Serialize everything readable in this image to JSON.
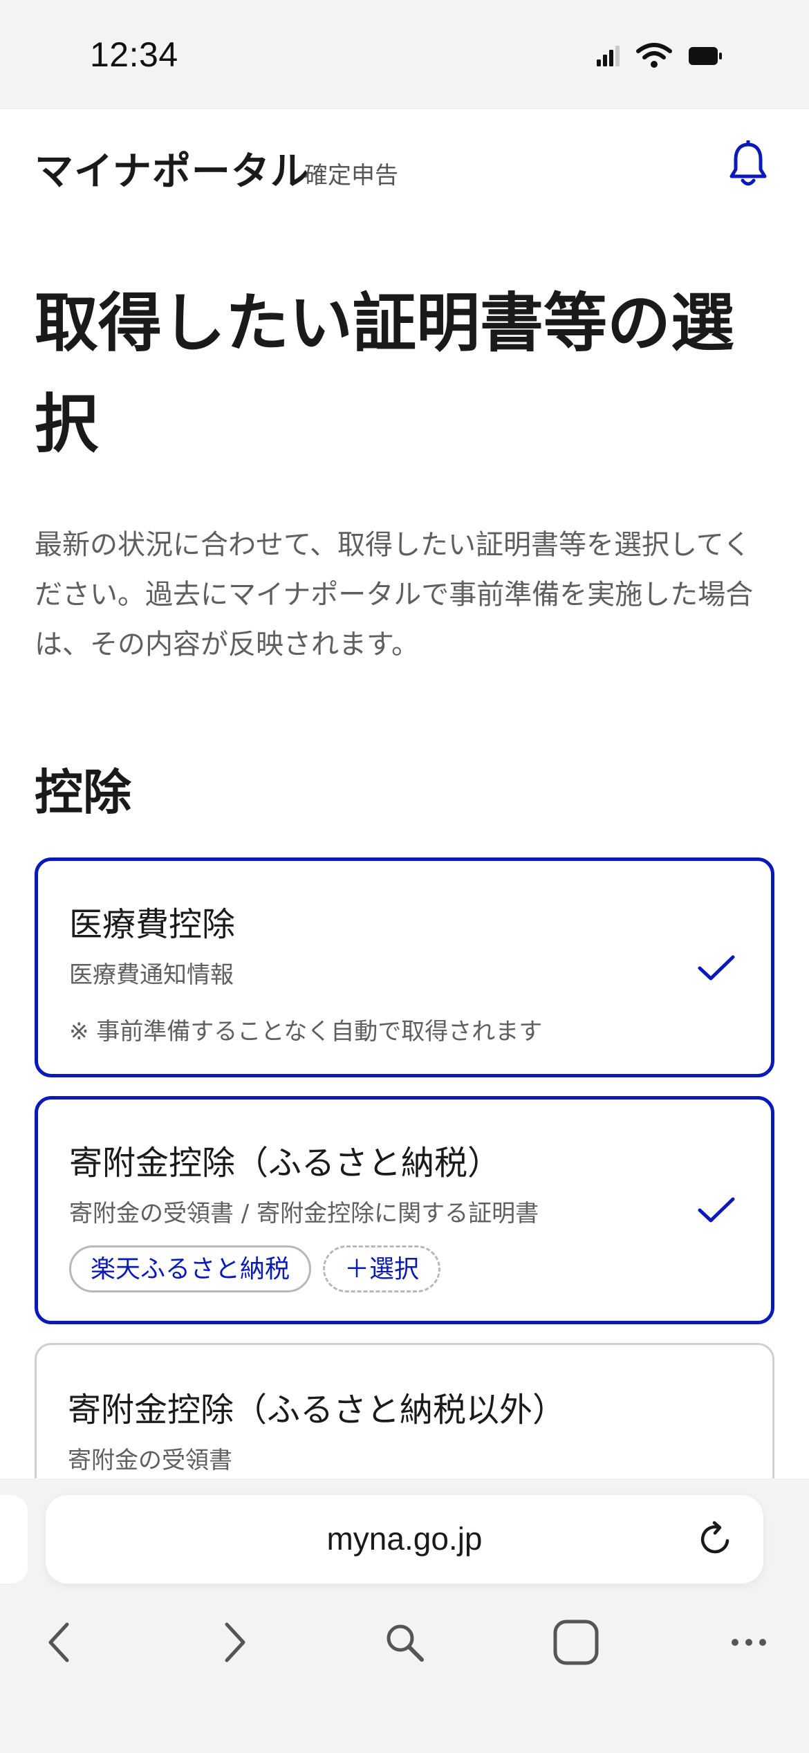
{
  "status_bar": {
    "time": "12:34"
  },
  "header": {
    "title": "マイナポータル",
    "subtitle": "確定申告",
    "icons": [
      "bell-icon"
    ]
  },
  "main": {
    "title": "取得したい証明書等の選択",
    "description": "最新の状況に合わせて、取得したい証明書等を選択してください。過去にマイナポータルで事前準備を実施した場合は、その内容が反映されます。",
    "section_heading": "控除"
  },
  "cards": [
    {
      "title": "医療費控除",
      "subtitle": "医療費通知情報",
      "note": "※ 事前準備することなく自動で取得されます",
      "selected": true
    },
    {
      "title": "寄附金控除（ふるさと納税）",
      "subtitle": "寄附金の受領書 / 寄附金控除に関する証明書",
      "chips": [
        "楽天ふるさと納税",
        "＋選択"
      ],
      "selected": true
    },
    {
      "title": "寄附金控除（ふるさと納税以外）",
      "subtitle": "寄附金の受領書",
      "selected": false
    }
  ],
  "browser": {
    "url": "myna.go.jp",
    "nav_icons": [
      "back-icon",
      "forward-icon",
      "search-icon",
      "tabs-icon",
      "more-icon"
    ]
  },
  "colors": {
    "accent": "#0a1ab8",
    "background": "#ffffff",
    "chrome_background": "#f3f3f4",
    "muted_text": "#5f5f5f"
  }
}
